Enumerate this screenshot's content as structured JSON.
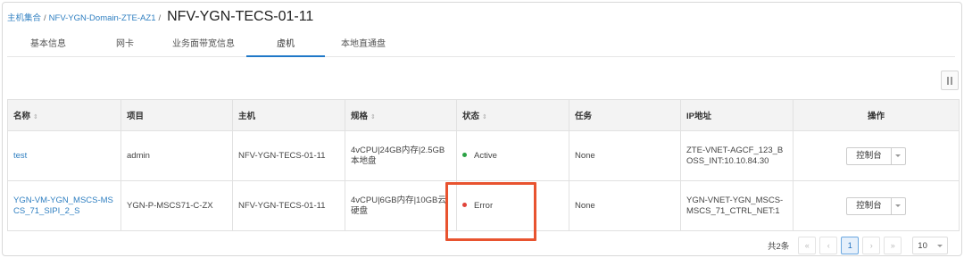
{
  "breadcrumb": {
    "items": [
      "主机集合",
      "NFV-YGN-Domain-ZTE-AZ1"
    ],
    "separator": "/",
    "title": "NFV-YGN-TECS-01-11"
  },
  "tabs": [
    {
      "label": "基本信息",
      "active": false
    },
    {
      "label": "网卡",
      "active": false
    },
    {
      "label": "业务面带宽信息",
      "active": false
    },
    {
      "label": "虚机",
      "active": true
    },
    {
      "label": "本地直通盘",
      "active": false
    }
  ],
  "table": {
    "columns": [
      "名称",
      "项目",
      "主机",
      "规格",
      "状态",
      "任务",
      "IP地址",
      "操作"
    ],
    "sort_icon": "⇕",
    "rows": [
      {
        "name": "test",
        "project": "admin",
        "host": "NFV-YGN-TECS-01-11",
        "spec": "4vCPU|24GB内存|2.5GB本地盘",
        "status": "Active",
        "status_color": "#2ba245",
        "task": "None",
        "ip": "ZTE-VNET-AGCF_123_BOSS_INT:10.10.84.30",
        "action": "控制台"
      },
      {
        "name": "YGN-VM-YGN_MSCS-MSCS_71_SIPI_2_S",
        "project": "YGN-P-MSCS71-C-ZX",
        "host": "NFV-YGN-TECS-01-11",
        "spec": "4vCPU|6GB内存|10GB云硬盘",
        "status": "Error",
        "status_color": "#e0443a",
        "task": "None",
        "ip": "YGN-VNET-YGN_MSCS-MSCS_71_CTRL_NET:1",
        "action": "控制台"
      }
    ]
  },
  "pagination": {
    "total_label": "共2条",
    "first": "«",
    "prev": "‹",
    "current_page": "1",
    "next": "›",
    "last": "»",
    "page_size": "10"
  },
  "colors": {
    "accent": "#1f78c8",
    "link": "#2f7fc1",
    "highlight": "#e8532f"
  }
}
